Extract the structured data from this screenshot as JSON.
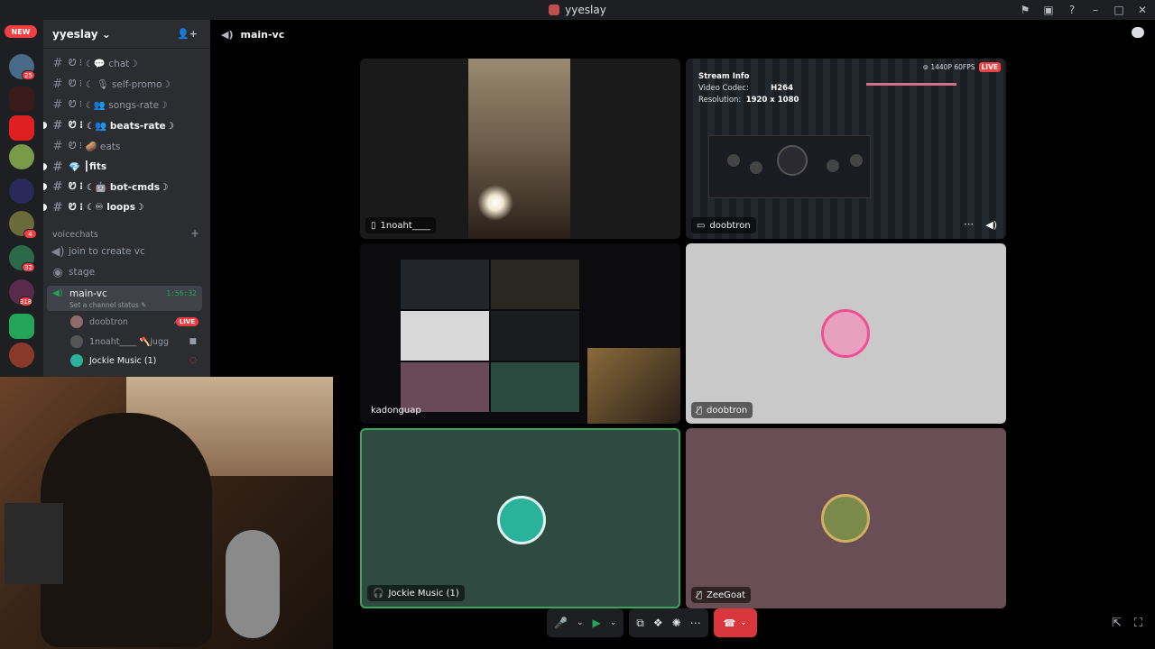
{
  "window": {
    "title": "yyeslay"
  },
  "servers": {
    "new_badge": "NEW",
    "badges": [
      "25",
      "4",
      "32",
      "318"
    ]
  },
  "guild": {
    "name": "yyeslay ⌄"
  },
  "channels": [
    {
      "label": "☾💬 chat☽",
      "prefix": "Ꮼ ⁝",
      "bold": false,
      "unread": false
    },
    {
      "label": "☾ 🎙 self-promo☽",
      "prefix": "Ꮼ ⁝",
      "bold": false,
      "unread": false
    },
    {
      "label": "☾👥 songs-rate☽",
      "prefix": "Ꮼ ⁝",
      "bold": false,
      "unread": false
    },
    {
      "label": "☾👥 beats-rate☽",
      "prefix": "Ꮼ ⁝",
      "bold": true,
      "unread": true
    },
    {
      "label": "🥔 eats",
      "prefix": "Ꮼ ⁝",
      "bold": false,
      "unread": false
    },
    {
      "label": "┃fits",
      "prefix": "💎",
      "bold": true,
      "unread": true
    },
    {
      "label": "☾🤖 bot-cmds☽",
      "prefix": "Ꮼ ⁝",
      "bold": true,
      "unread": true
    },
    {
      "label": "☾♾ loops☽",
      "prefix": "Ꮼ ⁝",
      "bold": true,
      "unread": true
    }
  ],
  "voice_category": "voicechats",
  "voice_channels": [
    {
      "label": "join to create vc"
    },
    {
      "label": "stage"
    }
  ],
  "active_voice": {
    "name": "main-vc",
    "time": "1:56:32",
    "status": "Set a channel status ✎"
  },
  "voice_users": [
    {
      "name": "doobtron",
      "live": "LIVE",
      "color": "#8e6a6a"
    },
    {
      "name": "1noaht____ 🪓jugg",
      "live": "",
      "color": "#555"
    },
    {
      "name": "Jockie Music (1)",
      "live": "",
      "color": "#2bb29a"
    }
  ],
  "topbar": {
    "channel": "main-vc"
  },
  "tiles": [
    {
      "name": "1noaht____",
      "icon": "▯"
    },
    {
      "name": "doobtron",
      "icon": "▭"
    },
    {
      "name": "kadonguap",
      "icon": ""
    },
    {
      "name": "doobtron",
      "icon": "🎙̸"
    },
    {
      "name": "Jockie Music (1)",
      "icon": "🎧"
    },
    {
      "name": "ZeeGoat",
      "icon": "🎙̸"
    }
  ],
  "stream_info": {
    "title": "Stream Info",
    "codec_label": "Video Codec:",
    "codec": "H264",
    "res_label": "Resolution:",
    "resolution": "1920 x 1080",
    "quality": "⊚ 1440P 60FPS",
    "live": "LIVE"
  },
  "controls": {
    "mic": "🎤",
    "cam": "▶",
    "share": "⧉",
    "activities": "❖",
    "soundboard": "✺",
    "more": "⋯",
    "hangup": "☎"
  }
}
